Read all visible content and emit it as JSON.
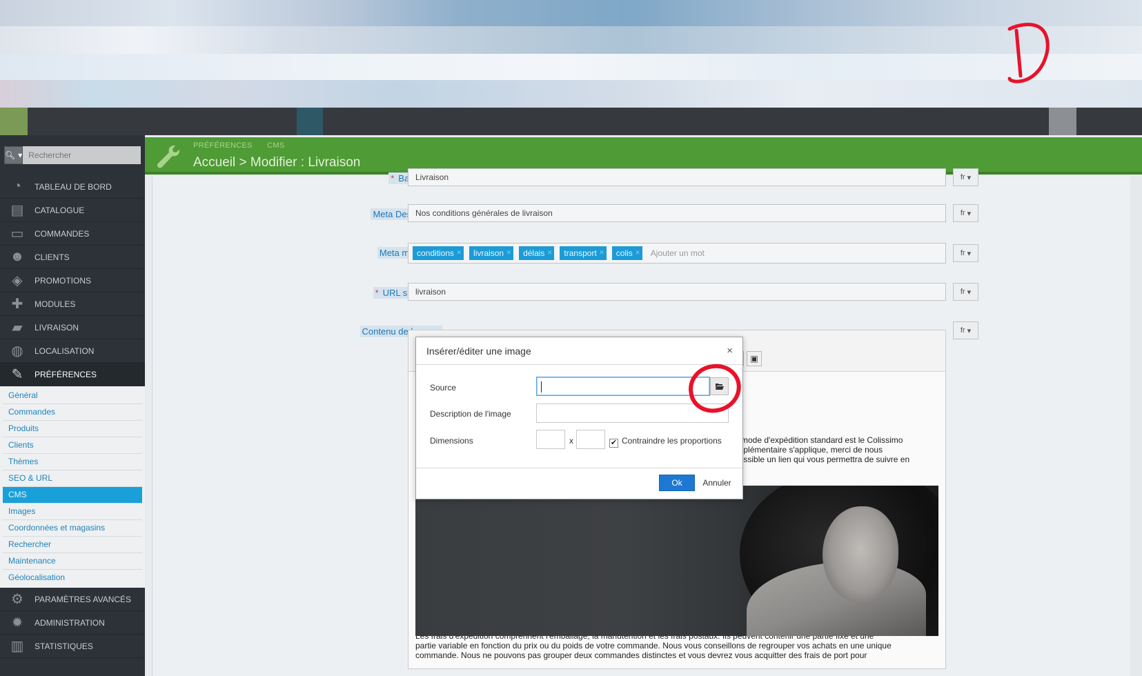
{
  "sidebar": {
    "search_label": "Q",
    "search_placeholder": "Rechercher",
    "items": [
      {
        "label": "TABLEAU DE BORD",
        "icon": "dashboard-icon"
      },
      {
        "label": "CATALOGUE",
        "icon": "book-icon"
      },
      {
        "label": "COMMANDES",
        "icon": "credit-card-icon"
      },
      {
        "label": "CLIENTS",
        "icon": "users-icon"
      },
      {
        "label": "PROMOTIONS",
        "icon": "tags-icon"
      },
      {
        "label": "MODULES",
        "icon": "puzzle-icon"
      },
      {
        "label": "LIVRAISON",
        "icon": "truck-icon"
      },
      {
        "label": "LOCALISATION",
        "icon": "globe-icon"
      },
      {
        "label": "PRÉFÉRENCES",
        "icon": "wrench-icon"
      }
    ],
    "sub_items": [
      "Général",
      "Commandes",
      "Produits",
      "Clients",
      "Thèmes",
      "SEO & URL",
      "CMS",
      "Images",
      "Coordonnées et magasins",
      "Rechercher",
      "Maintenance",
      "Géolocalisation"
    ],
    "active_sub": "CMS",
    "bottom_items": [
      {
        "label": "PARAMÈTRES AVANCÉS",
        "icon": "cogs-icon"
      },
      {
        "label": "ADMINISTRATION",
        "icon": "cog-icon"
      },
      {
        "label": "STATISTIQUES",
        "icon": "bar-chart-icon"
      }
    ]
  },
  "header": {
    "breadcrumb_1": "PRÉFÉRENCES",
    "breadcrumb_2": "CMS",
    "title": "Accueil > Modifier : Livraison"
  },
  "form": {
    "title_label": "Balise titre",
    "title_value": "Livraison",
    "meta_desc_label": "Meta Description",
    "meta_desc_value": "Nos conditions générales de livraison",
    "meta_keywords_label": "Meta mots-clés",
    "keywords": [
      "conditions",
      "livraison",
      "délais",
      "transport",
      "colis"
    ],
    "keyword_placeholder": "Ajouter un mot",
    "url_label": "URL simplifiée",
    "url_value": "livraison",
    "content_label": "Contenu de la page",
    "lang": "fr"
  },
  "editor": {
    "text_right_1": "e mode d'expédition standard est le Colissimo",
    "text_right_2": "upplémentaire s'applique, merci de nous",
    "text_right_3": "possible un lien qui vous permettra de suivre en",
    "bottom_1": "Les frais d'expédition comprennent l'emballage, la manutention et les frais postaux. Ils peuvent contenir une partie fixe et une",
    "bottom_2": "partie variable en fonction du prix ou du poids de votre commande. Nous vous conseillons de regrouper vos achats en une unique",
    "bottom_3": "commande. Nous ne pouvons pas grouper deux commandes distinctes et vous devrez vous acquitter des frais de port pour"
  },
  "dialog": {
    "title": "Insérer/éditer une image",
    "close": "×",
    "source_label": "Source",
    "source_value": "",
    "desc_label": "Description de l'image",
    "dims_label": "Dimensions",
    "dims_sep": "x",
    "constrain_label": "Contraindre les proportions",
    "constrain_checked": "✔",
    "ok": "Ok",
    "cancel": "Annuler"
  },
  "colors": {
    "header_green": "#4f9b35",
    "sidebar_dark": "#2d3238",
    "accent_blue": "#1aa0d8",
    "annotation_red": "#e8122a"
  }
}
